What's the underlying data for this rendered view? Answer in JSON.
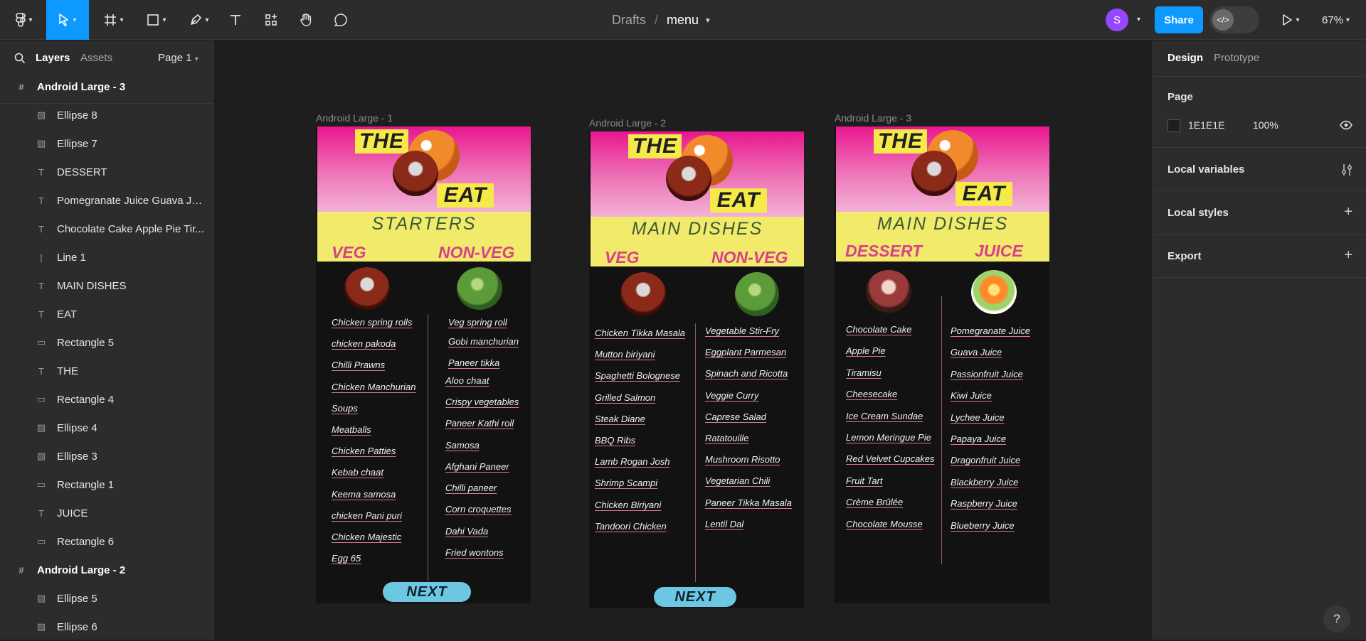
{
  "topbar": {
    "project": "Drafts",
    "separator": "/",
    "file_name": "menu",
    "avatar_initial": "S",
    "share_label": "Share",
    "zoom": "67%"
  },
  "left_panel": {
    "tabs": {
      "layers": "Layers",
      "assets": "Assets",
      "page": "Page 1"
    },
    "layers": [
      {
        "name": "Android Large - 3",
        "kind": "frame"
      },
      {
        "name": "Ellipse 8",
        "kind": "image"
      },
      {
        "name": "Ellipse 7",
        "kind": "image"
      },
      {
        "name": "DESSERT",
        "kind": "text"
      },
      {
        "name": "Pomegranate Juice Guava Jui...",
        "kind": "text"
      },
      {
        "name": "Chocolate Cake Apple Pie Tir...",
        "kind": "text"
      },
      {
        "name": "Line 1",
        "kind": "line"
      },
      {
        "name": "MAIN DISHES",
        "kind": "text"
      },
      {
        "name": "EAT",
        "kind": "text"
      },
      {
        "name": "Rectangle 5",
        "kind": "rect"
      },
      {
        "name": "THE",
        "kind": "text"
      },
      {
        "name": "Rectangle 4",
        "kind": "rect"
      },
      {
        "name": "Ellipse 4",
        "kind": "image"
      },
      {
        "name": "Ellipse 3",
        "kind": "image"
      },
      {
        "name": "Rectangle 1",
        "kind": "rect"
      },
      {
        "name": "JUICE",
        "kind": "text"
      },
      {
        "name": "Rectangle 6",
        "kind": "rect"
      },
      {
        "name": "Android Large - 2",
        "kind": "frame"
      },
      {
        "name": "Ellipse 5",
        "kind": "image"
      },
      {
        "name": "Ellipse 6",
        "kind": "image"
      }
    ]
  },
  "right_panel": {
    "tabs": {
      "design": "Design",
      "prototype": "Prototype"
    },
    "page_section_title": "Page",
    "page_color_hex": "1E1E1E",
    "page_opacity": "100%",
    "sections": [
      "Local variables",
      "Local styles",
      "Export"
    ]
  },
  "canvas": {
    "frames": [
      {
        "label": "Android Large - 1",
        "logo_the": "THE",
        "logo_eat": "EAT",
        "section": "STARTERS",
        "left_cat": "VEG",
        "right_cat": "NON-VEG",
        "left_items": [
          "Chicken spring rolls",
          "chicken pakoda",
          "Chilli Prawns",
          "Chicken Manchurian",
          "Soups",
          "Meatballs",
          "Chicken Patties",
          "Kebab chaat",
          "Keema samosa",
          " chicken Pani puri",
          "Chicken Majestic",
          "Egg 65"
        ],
        "right_items": [
          "Veg spring roll",
          "Gobi manchurian",
          " Paneer tikka",
          "Aloo chaat",
          "Crispy vegetables",
          "Paneer Kathi roll",
          "Samosa",
          "Afghani Paneer",
          "Chilli paneer",
          "Corn croquettes",
          "Dahi Vada",
          "Fried wontons"
        ],
        "button": "NEXT"
      },
      {
        "label": "Android Large - 2",
        "logo_the": "THE",
        "logo_eat": "EAT",
        "section": "MAIN DISHES",
        "left_cat": "VEG",
        "right_cat": "NON-VEG",
        "left_items": [
          "Chicken Tikka Masala",
          "Mutton biriyani",
          " Spaghetti Bolognese",
          "Grilled Salmon ",
          " Steak Diane ",
          " BBQ Ribs ",
          " Lamb Rogan Josh",
          "Shrimp Scampi ",
          "Chicken Biriyani",
          " Tandoori Chicken"
        ],
        "right_items": [
          "Vegetable Stir-Fry",
          "Eggplant Parmesan",
          "Spinach and Ricotta ",
          "Veggie Curry",
          "Caprese Salad",
          "Ratatouille",
          "Mushroom Risotto",
          "Vegetarian Chili",
          "Paneer Tikka Masala",
          "Lentil Dal"
        ],
        "button": "NEXT"
      },
      {
        "label": "Android Large - 3",
        "logo_the": "THE",
        "logo_eat": "EAT",
        "section": "MAIN DISHES",
        "left_cat": "DESSERT",
        "right_cat": "JUICE",
        "left_items": [
          "Chocolate Cake",
          "Apple Pie",
          "Tiramisu",
          "Cheesecake",
          "Ice Cream Sundae",
          "Lemon Meringue Pie",
          "Red Velvet Cupcakes",
          "Fruit Tart",
          "Crème Brûlée",
          "Chocolate Mousse"
        ],
        "right_items": [
          "Pomegranate Juice",
          "Guava Juice",
          "Passionfruit Juice",
          "Kiwi Juice",
          "Lychee Juice",
          "Papaya Juice",
          "Dragonfruit Juice",
          "Blackberry Juice",
          "Raspberry Juice",
          "Blueberry Juice"
        ]
      }
    ]
  },
  "help_label": "?"
}
